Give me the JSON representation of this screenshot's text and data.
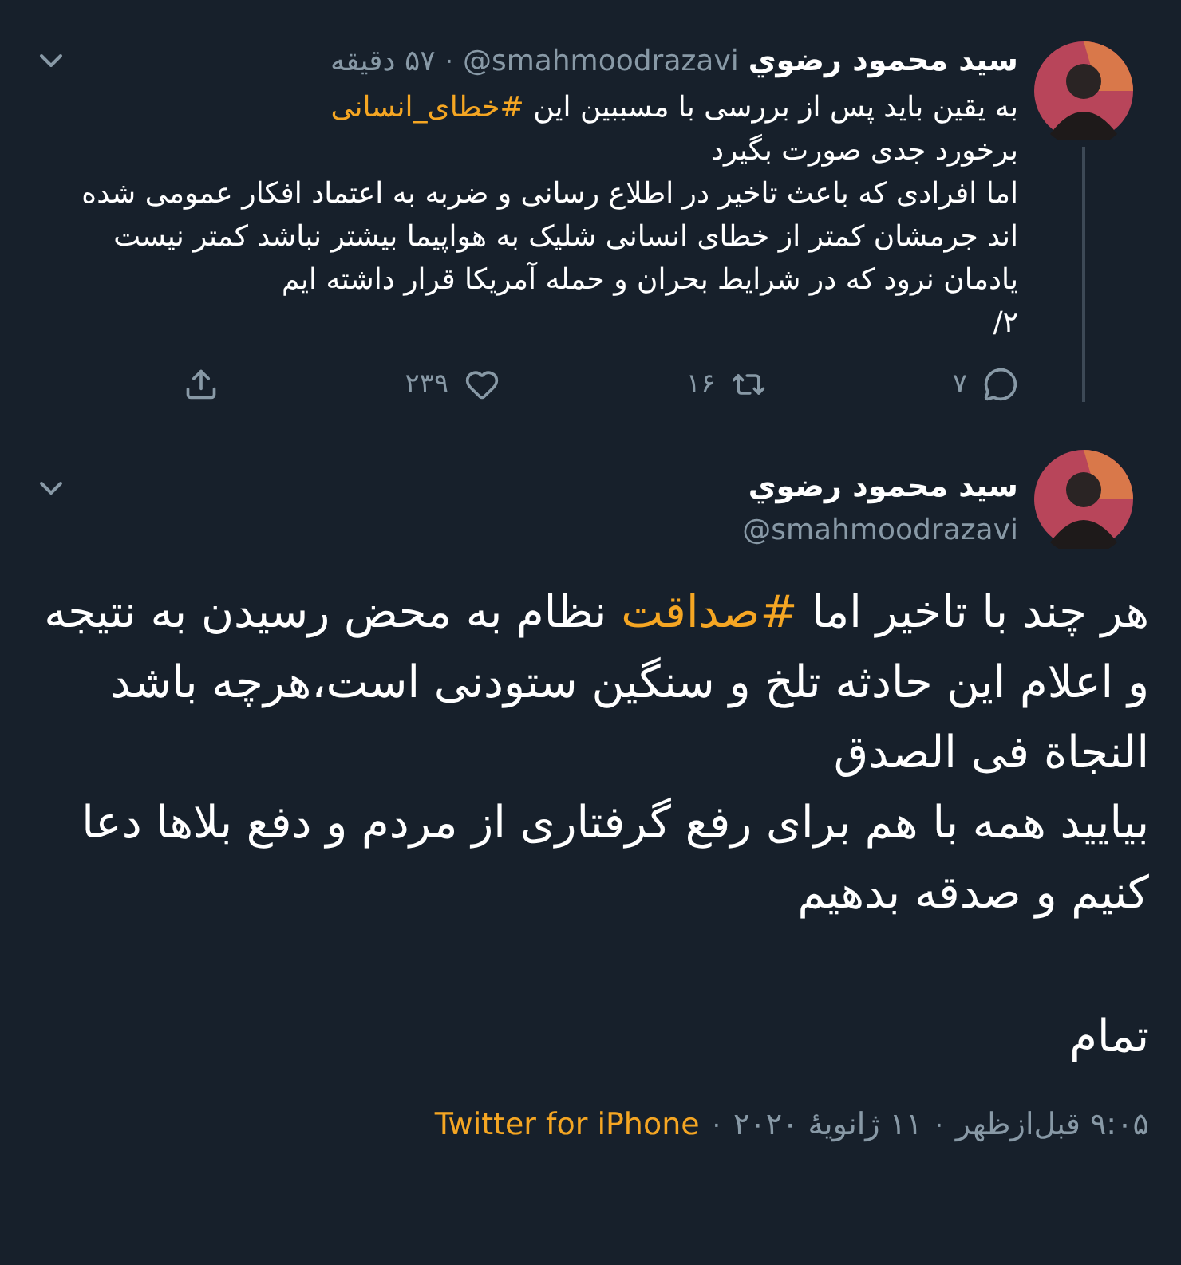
{
  "tweets": [
    {
      "author": {
        "name": "سيد محمود رضوي",
        "handle": "@smahmoodrazavi"
      },
      "separator": "·",
      "time": "۵۷ دقیقه",
      "paragraphs": [
        {
          "segments": [
            {
              "kind": "text",
              "text": "به یقین باید پس از بررسی با مسببین این "
            },
            {
              "kind": "hashtag",
              "text": "#خطای_انسانی"
            }
          ]
        },
        {
          "segments": [
            {
              "kind": "text",
              "text": "برخورد جدی صورت بگیرد"
            }
          ]
        },
        {
          "segments": [
            {
              "kind": "text",
              "text": "اما افرادی که باعث تاخیر در اطلاع رسانی و ضربه به اعتماد افکار عمومی شده اند جرمشان کمتر از خطای انسانی شلیک به هواپیما بیشتر نباشد کمتر نیست"
            }
          ]
        },
        {
          "segments": [
            {
              "kind": "text",
              "text": "یادمان نرود که در شرایط بحران و حمله آمریکا قرار داشته ایم"
            }
          ]
        },
        {
          "segments": [
            {
              "kind": "text",
              "text": "۲/"
            }
          ]
        }
      ],
      "actions": [
        {
          "kind": "reply",
          "count": "۷"
        },
        {
          "kind": "retweet",
          "count": "۱۶"
        },
        {
          "kind": "like",
          "count": "۲۳۹"
        },
        {
          "kind": "share"
        }
      ]
    },
    {
      "author": {
        "name": "سيد محمود رضوي",
        "handle": "@smahmoodrazavi"
      },
      "paragraphs": [
        {
          "segments": [
            {
              "kind": "text",
              "text": "هر چند با تاخیر اما "
            },
            {
              "kind": "hashtag",
              "text": "#صداقت"
            },
            {
              "kind": "text",
              "text": " نظام به محض رسیدن به نتیجه و اعلام این حادثه تلخ و سنگین ستودنی است،هرچه باشد النجاة فی الصدق"
            }
          ]
        },
        {
          "segments": [
            {
              "kind": "text",
              "text": "بیایید همه با هم برای رفع گرفتاری از مردم و دفع بلاها دعا کنیم و صدقه بدهیم"
            }
          ]
        },
        {
          "segments": [
            {
              "kind": "text",
              "text": "تمام"
            }
          ],
          "gap_before": true
        }
      ],
      "footer": {
        "time": "۹:۰۵ قبل‌ازظهر",
        "date": "۱۱ ژانویهٔ ۲۰۲۰",
        "source": "Twitter for iPhone",
        "separator": "·"
      }
    }
  ]
}
